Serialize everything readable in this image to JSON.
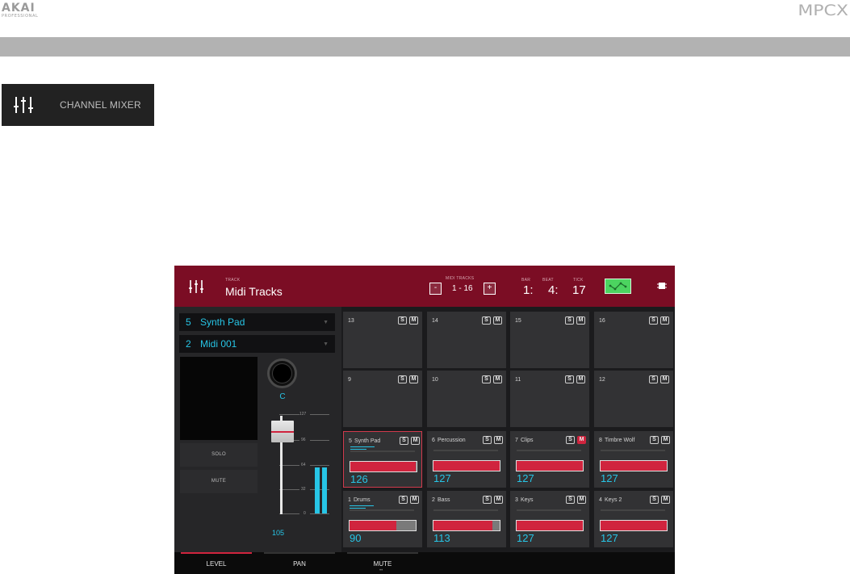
{
  "doc": {
    "brand": "AKAI",
    "brand_sub": "PROFESSIONAL",
    "product": "MPCX",
    "mode_label": "CHANNEL MIXER"
  },
  "screen": {
    "header": {
      "track_caption": "TRACK",
      "track_name": "Midi Tracks",
      "range_caption": "MIDI TRACKS",
      "range_value": "1 - 16",
      "minus": "-",
      "plus": "+",
      "bar_caption": "BAR",
      "beat_caption": "BEAT",
      "tick_caption": "TICK",
      "bar": "1:",
      "beat": "4:",
      "tick": "17"
    },
    "selectors": [
      {
        "num": "5",
        "name": "Synth Pad"
      },
      {
        "num": "2",
        "name": "Midi 001"
      }
    ],
    "solo_label": "SOLO",
    "mute_label": "MUTE",
    "pan_value": "C",
    "fader": {
      "level": 105,
      "scale": [
        "127",
        "96",
        "64",
        "32",
        "0"
      ],
      "level_label": "105"
    },
    "pads": [
      {
        "num": "13",
        "name": "",
        "muted": false,
        "level": null
      },
      {
        "num": "14",
        "name": "",
        "muted": false,
        "level": null
      },
      {
        "num": "15",
        "name": "",
        "muted": false,
        "level": null
      },
      {
        "num": "16",
        "name": "",
        "muted": false,
        "level": null
      },
      {
        "num": "9",
        "name": "",
        "muted": false,
        "level": null
      },
      {
        "num": "10",
        "name": "",
        "muted": false,
        "level": null
      },
      {
        "num": "11",
        "name": "",
        "muted": false,
        "level": null
      },
      {
        "num": "12",
        "name": "",
        "muted": false,
        "level": null
      },
      {
        "num": "5",
        "name": "Synth Pad",
        "muted": false,
        "level": "126",
        "fill": 0.99,
        "selected": true,
        "activity": true
      },
      {
        "num": "6",
        "name": "Percussion",
        "muted": false,
        "level": "127",
        "fill": 1.0
      },
      {
        "num": "7",
        "name": "Clips",
        "muted": true,
        "level": "127",
        "fill": 1.0
      },
      {
        "num": "8",
        "name": "Timbre Wolf",
        "muted": false,
        "level": "127",
        "fill": 1.0
      },
      {
        "num": "1",
        "name": "Drums",
        "muted": false,
        "level": "90",
        "fill": 0.71,
        "activity": true
      },
      {
        "num": "2",
        "name": "Bass",
        "muted": false,
        "level": "113",
        "fill": 0.89
      },
      {
        "num": "3",
        "name": "Keys",
        "muted": false,
        "level": "127",
        "fill": 1.0
      },
      {
        "num": "4",
        "name": "Keys 2",
        "muted": false,
        "level": "127",
        "fill": 1.0
      }
    ],
    "solo_btn": "S",
    "mute_btn": "M",
    "tabs": [
      {
        "label": "LEVEL",
        "active": true
      },
      {
        "label": "PAN",
        "active": false
      },
      {
        "label": "MUTE",
        "active": false
      }
    ]
  },
  "colors": {
    "accent": "#d0243e",
    "header": "#7b0d24",
    "cyan": "#27c5e6"
  }
}
